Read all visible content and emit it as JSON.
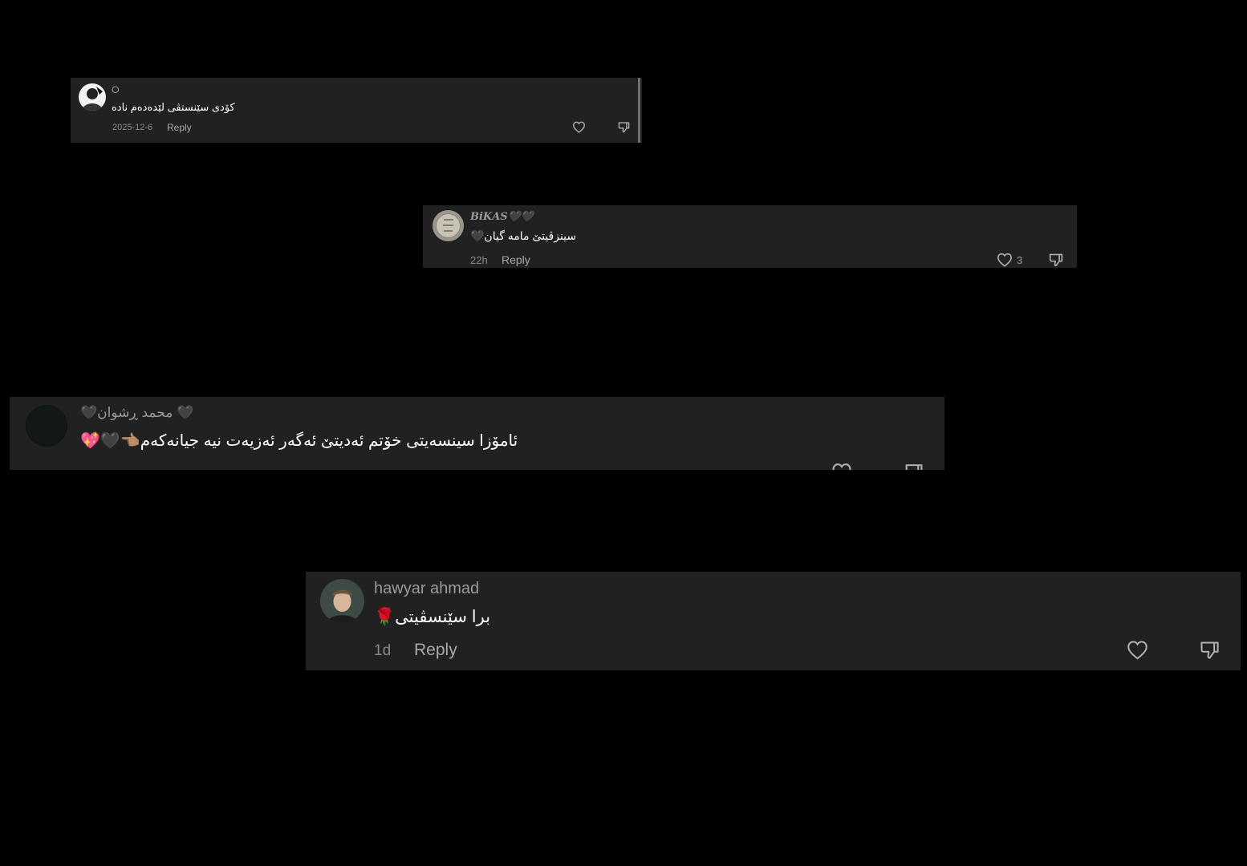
{
  "colors": {
    "background": "#000000",
    "card": "#212121",
    "username": "#9b9b9b",
    "meta": "#8a8a8a",
    "text": "#ffffff"
  },
  "comments": [
    {
      "username": "⭘",
      "text": "کۆدی سێنستڤی لێدەدەم نادە",
      "date": "2025-12-6",
      "reply_label": "Reply",
      "like_count": "",
      "avatar_icon": "user-avatar-icon"
    },
    {
      "username": "𝑩𝒊𝑲𝑨𝑺🖤🖤",
      "text": "سینزڤیتێ مامە گیان🖤",
      "date": "22h",
      "reply_label": "Reply",
      "like_count": "3",
      "avatar_icon": "user-avatar-icon"
    },
    {
      "username": "🖤 محمد ڕشوان🖤",
      "text": "ئامۆزا سینسەیتی خۆتم ئەدیتێ ئەگەر ئەزیەت نیە جیانەکەم👈🏽🖤💖",
      "date": "",
      "reply_label": "",
      "like_count": "",
      "avatar_icon": "user-avatar-icon"
    },
    {
      "username": "hawyar ahmad",
      "text": "برا سێنسڤیتی🌹",
      "date": "1d",
      "reply_label": "Reply",
      "like_count": "",
      "avatar_icon": "user-avatar-icon"
    }
  ]
}
